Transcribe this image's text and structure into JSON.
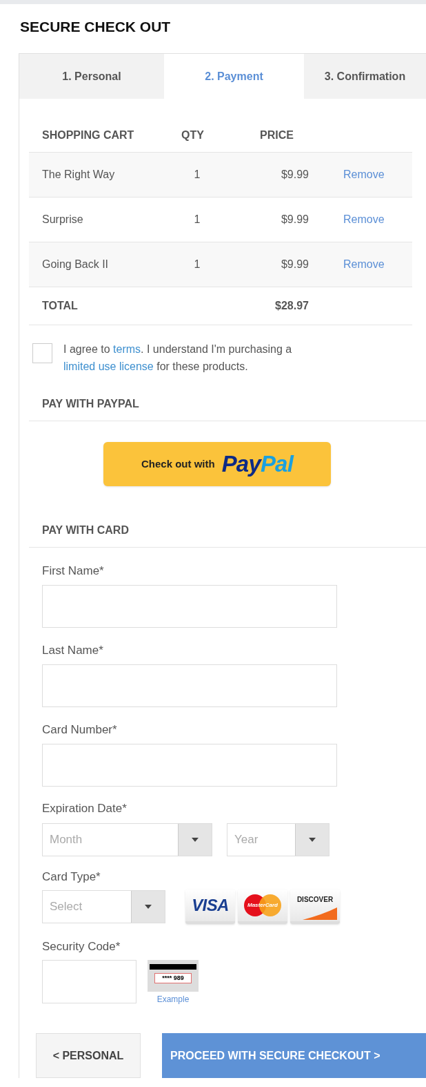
{
  "title": "SECURE CHECK OUT",
  "tabs": [
    {
      "label": "1. Personal",
      "selected": false
    },
    {
      "label": "2. Payment",
      "selected": true
    },
    {
      "label": "3. Confirmation",
      "selected": false
    }
  ],
  "cart": {
    "columns": [
      "SHOPPING CART",
      "QTY",
      "PRICE"
    ],
    "rows": [
      {
        "name": "The Right Way",
        "qty": "1",
        "price": "$9.99",
        "action": "Remove"
      },
      {
        "name": "Surprise",
        "qty": "1",
        "price": "$9.99",
        "action": "Remove"
      },
      {
        "name": "Going Back II",
        "qty": "1",
        "price": "$9.99",
        "action": "Remove"
      }
    ],
    "total_label": "TOTAL",
    "total": "$28.97"
  },
  "agreement": {
    "checked": false,
    "text": "I agree to ",
    "terms_link": "terms",
    "text_2": ".  I understand I'm purchasing a",
    "license_link": "limited use license",
    "text_3": " for these products."
  },
  "paypal": {
    "heading": "PAY WITH PAYPAL",
    "button_text": "Check out with",
    "logo_parts": [
      "Pay",
      "Pal"
    ]
  },
  "card": {
    "heading": "PAY WITH CARD",
    "fields": [
      {
        "label": "First Name*"
      },
      {
        "label": "Last Name*"
      },
      {
        "label": "Card Number*"
      }
    ],
    "expiration": {
      "label": "Expiration Date*",
      "month_placeholder": "Month",
      "year_placeholder": "Year"
    },
    "card_type": {
      "label": "Card Type*",
      "placeholder": "Select",
      "logos": [
        "VISA",
        "MasterCard",
        "DISCOVER"
      ]
    },
    "security": {
      "label": "Security Code*",
      "example_digits": "**** 989",
      "example_link": "Example"
    }
  },
  "buttons": {
    "back": "< PERSONAL",
    "proceed": "PROCEED WITH SECURE CHECKOUT >"
  }
}
